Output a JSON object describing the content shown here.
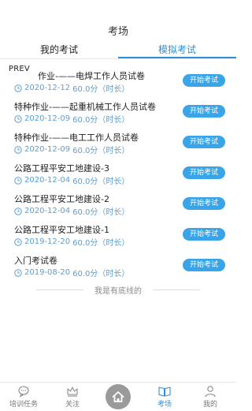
{
  "header": {
    "title": "考场"
  },
  "tabs": [
    {
      "label": "我的考试"
    },
    {
      "label": "模拟考试"
    }
  ],
  "prev_label": "PREV",
  "exams": [
    {
      "title": "作业-——电焊工作人员试卷",
      "date": "2020-12-12",
      "duration": "60.0分（时长）",
      "button": "开始考试"
    },
    {
      "title": "特种作业-——起重机械工作人员试卷",
      "date": "2020-12-09",
      "duration": "60.0分（时长）",
      "button": "开始考试"
    },
    {
      "title": "特种作业-——电工工作人员试卷",
      "date": "2020-12-09",
      "duration": "60.0分（时长）",
      "button": "开始考试"
    },
    {
      "title": "公路工程平安工地建设-3",
      "date": "2020-12-04",
      "duration": "60.0分（时长）",
      "button": "开始考试"
    },
    {
      "title": "公路工程平安工地建设-2",
      "date": "2020-12-04",
      "duration": "60.0分（时长）",
      "button": "开始考试"
    },
    {
      "title": "公路工程平安工地建设-1",
      "date": "2019-12-20",
      "duration": "60.0分（时长）",
      "button": "开始考试"
    },
    {
      "title": "入门考试卷",
      "date": "2019-08-20",
      "duration": "60.0分（时长）",
      "button": "开始考试"
    }
  ],
  "end_text": "我是有底线的",
  "bottom_nav": [
    {
      "label": "培训任务",
      "icon": "chat-bubble-icon"
    },
    {
      "label": "关注",
      "icon": "crown-icon"
    },
    {
      "label": "",
      "icon": "home-icon"
    },
    {
      "label": "考场",
      "icon": "book-icon"
    },
    {
      "label": "我的",
      "icon": "person-icon"
    }
  ],
  "colors": {
    "accent": "#2f8fd8",
    "button": "#3aa4e8",
    "meta": "#5aa0d6"
  }
}
